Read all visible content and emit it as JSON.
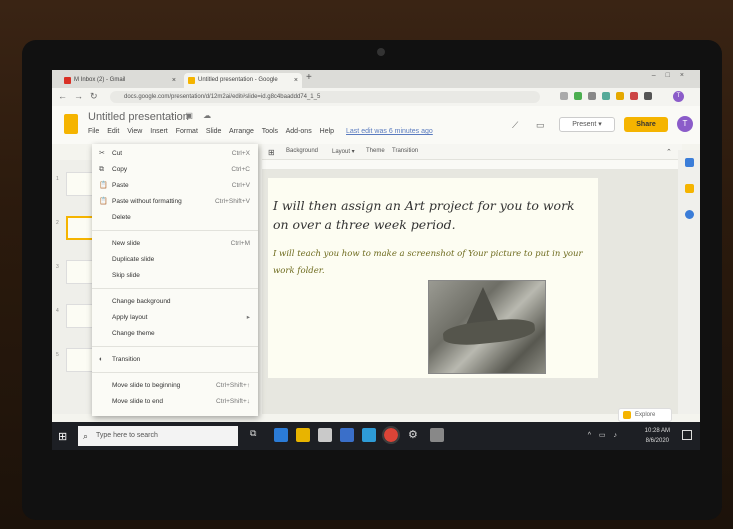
{
  "browser": {
    "tabs": [
      {
        "label": "M  Inbox (2) - Gmail",
        "favicon_color": "#d93025"
      },
      {
        "label": "Untitled presentation - Google",
        "favicon_color": "#f5b400"
      }
    ],
    "url": "docs.google.com/presentation/d/12m2ai/edit#slide=id.g8c4baaddd74_1_5"
  },
  "app": {
    "doc_title": "Untitled presentation",
    "menu": [
      "File",
      "Edit",
      "View",
      "Insert",
      "Format",
      "Slide",
      "Arrange",
      "Tools",
      "Add-ons",
      "Help"
    ],
    "last_edit": "Last edit was 6 minutes ago",
    "present_label": "Present",
    "share_label": "Share",
    "avatar_letter": "T"
  },
  "toolbar": {
    "background": "Background",
    "layout": "Layout ▾",
    "theme": "Theme",
    "transition": "Transition"
  },
  "context_menu": {
    "items": [
      {
        "icon": "✂",
        "label": "Cut",
        "shortcut": "Ctrl+X"
      },
      {
        "icon": "⧉",
        "label": "Copy",
        "shortcut": "Ctrl+C"
      },
      {
        "icon": "📋",
        "label": "Paste",
        "shortcut": "Ctrl+V"
      },
      {
        "icon": "📋",
        "label": "Paste without formatting",
        "shortcut": "Ctrl+Shift+V"
      },
      {
        "icon": "",
        "label": "Delete",
        "shortcut": ""
      },
      {
        "icon": "",
        "label": "New slide",
        "shortcut": "Ctrl+M"
      },
      {
        "icon": "",
        "label": "Duplicate slide",
        "shortcut": ""
      },
      {
        "icon": "",
        "label": "Skip slide",
        "shortcut": ""
      },
      {
        "icon": "",
        "label": "Change background",
        "shortcut": ""
      },
      {
        "icon": "",
        "label": "Apply layout",
        "shortcut": "▸"
      },
      {
        "icon": "",
        "label": "Change theme",
        "shortcut": ""
      },
      {
        "icon": "◐",
        "label": "Transition",
        "shortcut": ""
      },
      {
        "icon": "",
        "label": "Move slide to beginning",
        "shortcut": "Ctrl+Shift+↑"
      },
      {
        "icon": "",
        "label": "Move slide to end",
        "shortcut": "Ctrl+Shift+↓"
      }
    ]
  },
  "slide": {
    "heading": "I will then assign an Art project for you to work on over a three week period.",
    "subtext": "I will teach you how to make a screenshot of Your picture to put in your work folder."
  },
  "explore_label": "Explore",
  "taskbar": {
    "search_placeholder": "Type here to search",
    "time": "10:28 AM",
    "date": "8/6/2020"
  }
}
